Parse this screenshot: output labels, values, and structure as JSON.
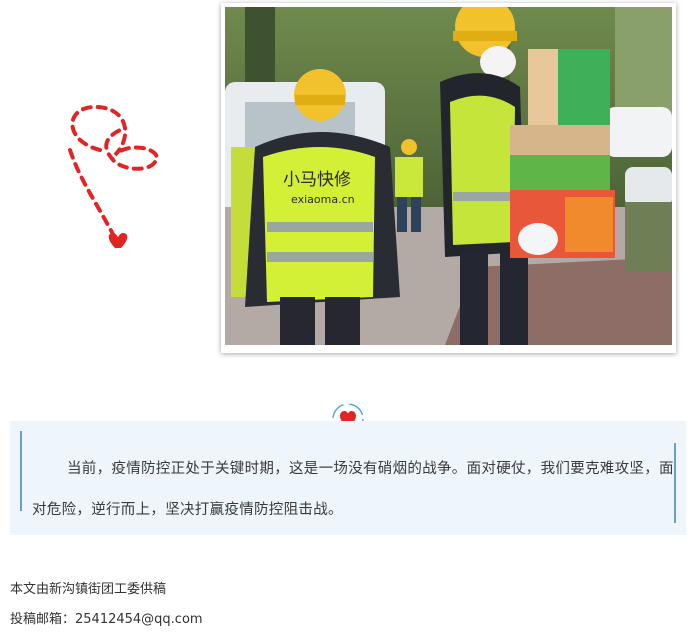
{
  "photo": {
    "vest_text_1": "小马快修",
    "vest_text_2": "exiaoma.cn"
  },
  "quote": {
    "text": "当前，疫情防控正处于关键时期，这是一场没有硝烟的战争。面对硬仗，我们要克难攻坚，面对危险，逆行而上，坚决打赢疫情防控阻击战。"
  },
  "footer": {
    "source": "本文由新沟镇街团工委供稿",
    "email": "投稿邮箱：25412454@qq.com"
  },
  "colors": {
    "accent_red": "#e02525",
    "quote_bg": "#eef6fb",
    "quote_bar": "#6a9fcb"
  }
}
